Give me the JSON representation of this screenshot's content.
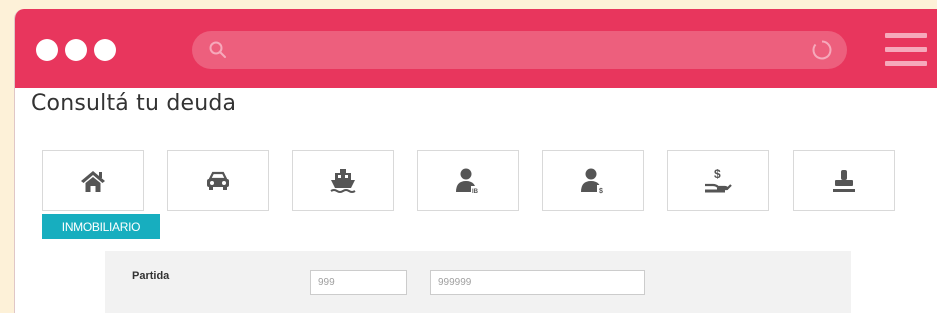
{
  "browser": {
    "window_controls": [
      "dot",
      "dot",
      "dot"
    ],
    "search_icon": "search-icon",
    "reload_icon": "reload-icon",
    "menu_icon": "hamburger-menu-icon",
    "colors": {
      "bar": "#e8365d",
      "url_field": "#ed5f7d",
      "icons": "#f6a9bb"
    }
  },
  "page": {
    "title": "Consultá tu deuda"
  },
  "categories": {
    "active_label": "INMOBILIARIO",
    "active_color": "#17aebf",
    "icon_color": "#555555",
    "tiles": [
      {
        "icon": "house-icon"
      },
      {
        "icon": "car-icon"
      },
      {
        "icon": "boat-icon"
      },
      {
        "icon": "person-ib-icon"
      },
      {
        "icon": "person-dollar-icon"
      },
      {
        "icon": "hand-money-icon"
      },
      {
        "icon": "stamp-icon"
      }
    ]
  },
  "form": {
    "label": "Partida",
    "field1_placeholder": "999",
    "field2_placeholder": "999999"
  }
}
